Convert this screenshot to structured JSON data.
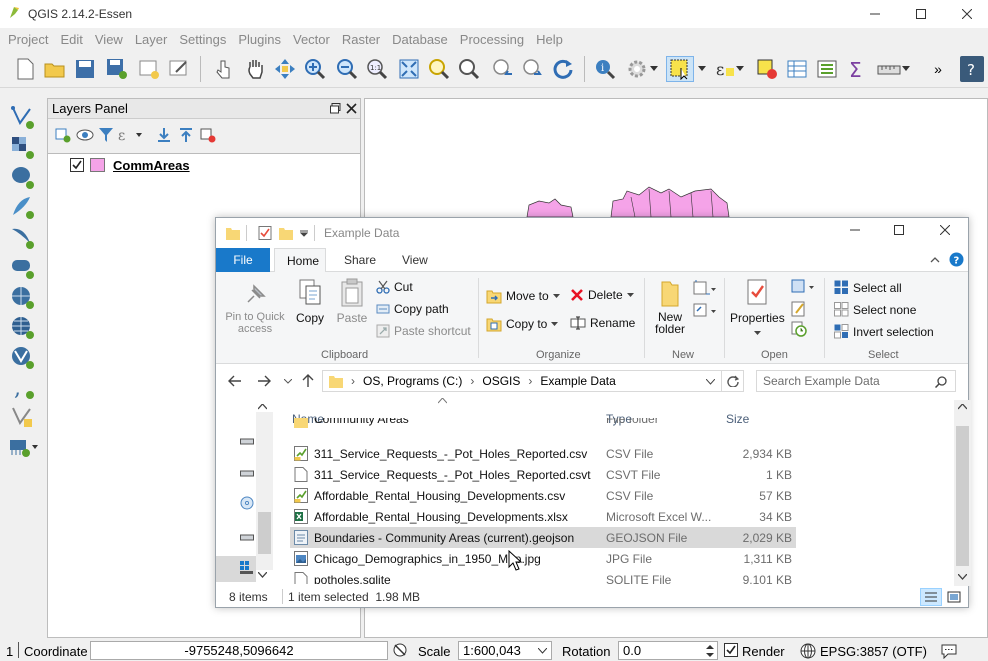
{
  "qgis": {
    "title": "QGIS 2.14.2-Essen",
    "menu": [
      "Project",
      "Edit",
      "View",
      "Layer",
      "Settings",
      "Plugins",
      "Vector",
      "Raster",
      "Database",
      "Processing",
      "Help"
    ],
    "toolbar_overflow": "»"
  },
  "layers_panel": {
    "title": "Layers Panel",
    "layers": [
      {
        "name": "CommAreas",
        "checked": true,
        "color": "#f5a3e8"
      }
    ]
  },
  "status": {
    "coord_label": "Coordinate",
    "coord_value": "-9755248,5096642",
    "scale_label": "Scale",
    "scale_value": "1:600,043",
    "rotation_label": "Rotation",
    "rotation_value": "0.0",
    "render_label": "Render",
    "render_checked": true,
    "crs": "EPSG:3857 (OTF)",
    "left_num": "1"
  },
  "explorer": {
    "title": "Example Data",
    "tabs": [
      "File",
      "Home",
      "Share",
      "View"
    ],
    "active_tab": "Home",
    "ribbon": {
      "clipboard": {
        "label": "Clipboard",
        "pin": "Pin to Quick access",
        "copy": "Copy",
        "paste": "Paste",
        "cut": "Cut",
        "copy_path": "Copy path",
        "paste_shortcut": "Paste shortcut"
      },
      "organize": {
        "label": "Organize",
        "move_to": "Move to",
        "copy_to": "Copy to",
        "delete": "Delete",
        "rename": "Rename"
      },
      "new": {
        "label": "New",
        "new_folder": "New folder"
      },
      "open": {
        "label": "Open",
        "properties": "Properties"
      },
      "select": {
        "label": "Select",
        "select_all": "Select all",
        "select_none": "Select none",
        "invert": "Invert selection"
      }
    },
    "path": [
      "OS, Programs (C:)",
      "OSGIS",
      "Example Data"
    ],
    "search_placeholder": "Search Example Data",
    "columns": {
      "name": "Name",
      "type": "Type",
      "size": "Size"
    },
    "files": [
      {
        "name": "Community Areas",
        "type": "File folder",
        "size": "",
        "icon": "folder-icon",
        "partial": true
      },
      {
        "name": "311_Service_Requests_-_Pot_Holes_Reported.csv",
        "type": "CSV File",
        "size": "2,934 KB",
        "icon": "csv-icon"
      },
      {
        "name": "311_Service_Requests_-_Pot_Holes_Reported.csvt",
        "type": "CSVT File",
        "size": "1 KB",
        "icon": "file-icon"
      },
      {
        "name": "Affordable_Rental_Housing_Developments.csv",
        "type": "CSV File",
        "size": "57 KB",
        "icon": "csv-icon"
      },
      {
        "name": "Affordable_Rental_Housing_Developments.xlsx",
        "type": "Microsoft Excel W...",
        "size": "34 KB",
        "icon": "excel-icon"
      },
      {
        "name": "Boundaries - Community Areas (current).geojson",
        "type": "GEOJSON File",
        "size": "2,029 KB",
        "icon": "geojson-icon",
        "selected": true
      },
      {
        "name": "Chicago_Demographics_in_1950_Map.jpg",
        "type": "JPG File",
        "size": "1,311 KB",
        "icon": "image-icon"
      },
      {
        "name": "potholes.sqlite",
        "type": "SQLITE File",
        "size": "9,101 KB",
        "icon": "file-icon"
      }
    ],
    "item_count": "8 items",
    "selection_info": "1 item selected  1.98 MB"
  },
  "colors": {
    "file_tab": "#1979ca",
    "selection": "#d9d9d9",
    "layer_fill": "#f5a3e8"
  }
}
